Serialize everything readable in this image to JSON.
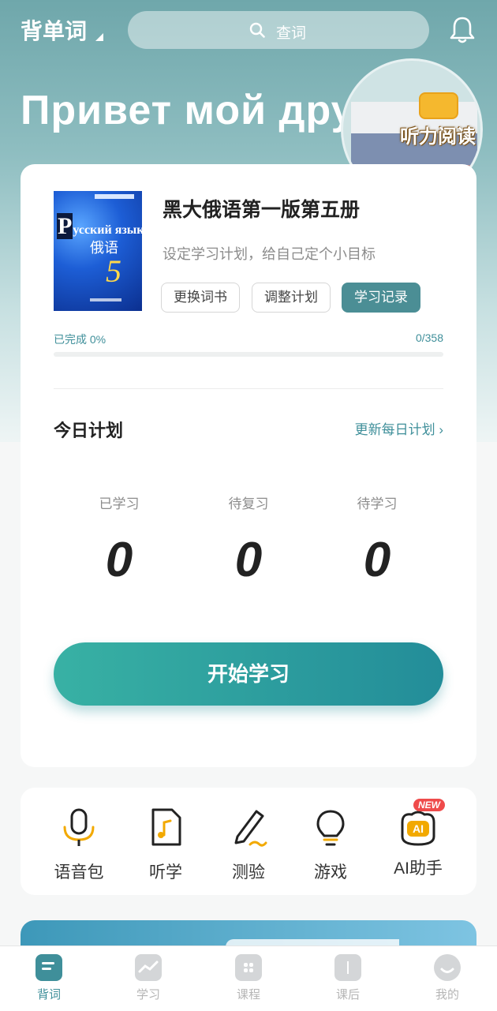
{
  "header": {
    "mode_title": "背单词",
    "search_placeholder": "查词"
  },
  "hero": {
    "greeting": "Привет мой друг",
    "promo_label": "听力阅读"
  },
  "book": {
    "cover_title_cap": "P",
    "cover_title": "усский язык",
    "cover_cn": "俄语",
    "cover_num": "5",
    "title": "黑大俄语第一版第五册",
    "subtitle": "设定学习计划，给自己定个小目标",
    "buttons": {
      "change": "更换词书",
      "adjust": "调整计划",
      "record": "学习记录"
    },
    "progress_label": "已完成 0%",
    "progress_count": "0/358",
    "progress_fraction": 0
  },
  "plan": {
    "title": "今日计划",
    "update_link": "更新每日计划",
    "stats": [
      {
        "label": "已学习",
        "value": "0"
      },
      {
        "label": "待复习",
        "value": "0"
      },
      {
        "label": "待学习",
        "value": "0"
      }
    ],
    "start_button": "开始学习"
  },
  "tools": [
    {
      "label": "语音包",
      "icon": "microphone-icon"
    },
    {
      "label": "听学",
      "icon": "music-file-icon"
    },
    {
      "label": "测验",
      "icon": "pen-icon"
    },
    {
      "label": "游戏",
      "icon": "lightbulb-icon"
    },
    {
      "label": "AI助手",
      "icon": "ai-assistant-icon",
      "badge": "NEW",
      "badge_text": "AI"
    }
  ],
  "tabs": [
    {
      "label": "背词",
      "icon": "book-icon",
      "active": true
    },
    {
      "label": "学习",
      "icon": "chart-icon",
      "active": false
    },
    {
      "label": "课程",
      "icon": "grid-icon",
      "active": false
    },
    {
      "label": "课后",
      "icon": "open-book-icon",
      "active": false
    },
    {
      "label": "我的",
      "icon": "face-icon",
      "active": false
    }
  ],
  "colors": {
    "accent": "#3f8f9a",
    "start_gradient_from": "#38b1a4",
    "start_gradient_to": "#238d99",
    "new_badge": "#ef4b4b"
  }
}
